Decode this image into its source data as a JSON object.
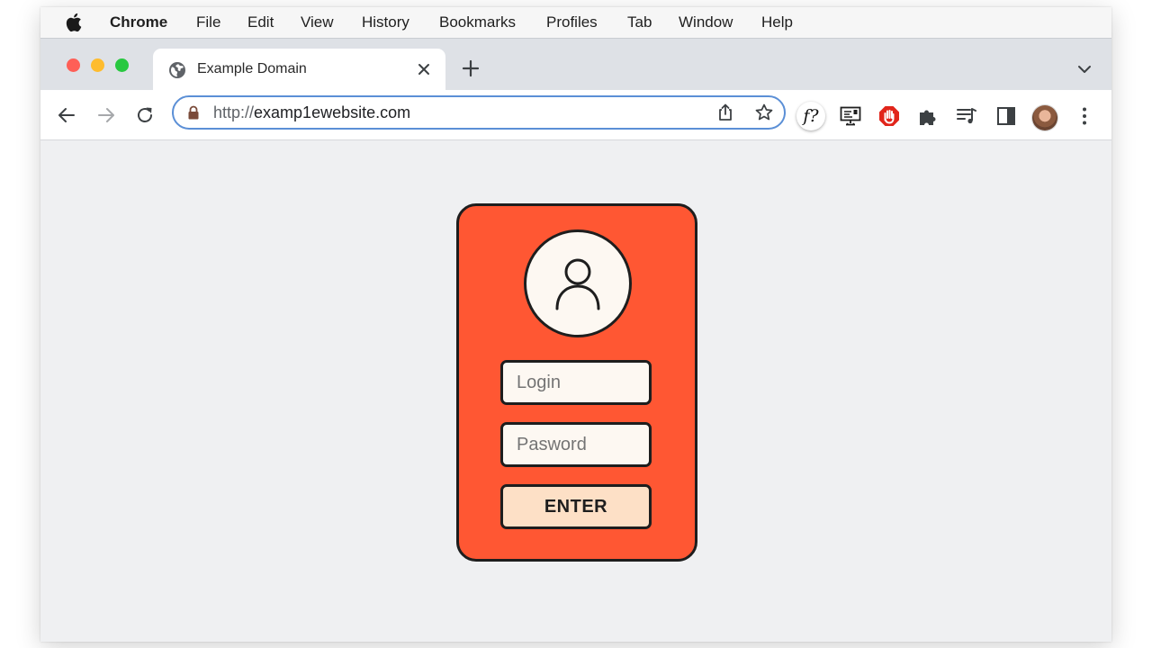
{
  "menubar": {
    "app": "Chrome",
    "items": [
      "File",
      "Edit",
      "View",
      "History",
      "Bookmarks",
      "Profiles",
      "Tab",
      "Window",
      "Help"
    ]
  },
  "tabs": [
    {
      "title": "Example Domain",
      "icon": "globe-icon",
      "active": true
    }
  ],
  "address_bar": {
    "scheme": "http://",
    "host": "examp1ewebsite.com",
    "security_icon": "not-secure-lock-icon"
  },
  "toolbar_icons": [
    "back-arrow-icon",
    "forward-arrow-icon",
    "reload-icon",
    "share-icon",
    "bookmark-star-icon"
  ],
  "extensions": {
    "font_finder_label": "f?",
    "icons": [
      "font-finder-extension-icon",
      "monitor-extension-icon",
      "adblock-stop-icon",
      "extensions-puzzle-icon",
      "media-playlist-icon",
      "side-panel-icon",
      "profile-avatar",
      "more-menu-icon"
    ]
  },
  "login_card": {
    "login_placeholder": "Login",
    "password_placeholder": "Pasword",
    "enter_label": "ENTER",
    "colors": {
      "card": "#ff5733",
      "input": "#fdf8f2",
      "button": "#fde0c6",
      "outline": "#1e1e1e"
    }
  }
}
